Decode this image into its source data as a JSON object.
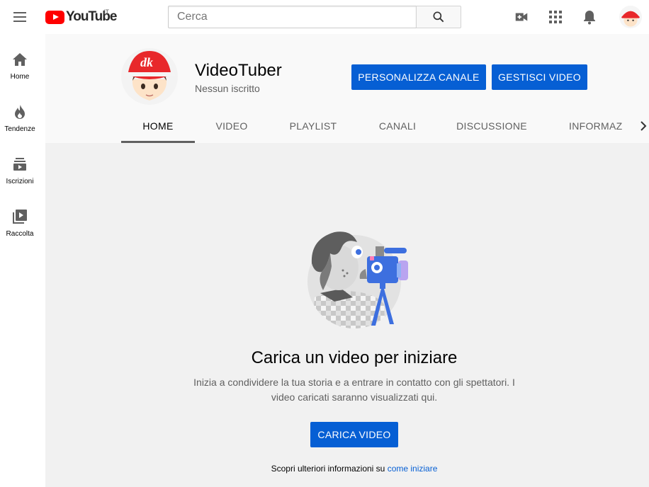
{
  "topbar": {
    "logo_text": "YouTube",
    "country_code": "IT",
    "search_placeholder": "Cerca"
  },
  "sidebar": {
    "items": [
      {
        "label": "Home",
        "icon": "home-icon"
      },
      {
        "label": "Tendenze",
        "icon": "flame-icon"
      },
      {
        "label": "Iscrizioni",
        "icon": "subscriptions-icon"
      },
      {
        "label": "Raccolta",
        "icon": "library-icon"
      }
    ]
  },
  "channel": {
    "avatar_text": "dk",
    "name": "VideoTuber",
    "subscribers": "Nessun iscritto",
    "customize_label": "PERSONALIZZA CANALE",
    "manage_label": "GESTISCI VIDEO",
    "tabs": [
      "HOME",
      "VIDEO",
      "PLAYLIST",
      "CANALI",
      "DISCUSSIONE",
      "INFORMAZIONI"
    ],
    "active_tab": "HOME"
  },
  "empty_state": {
    "title": "Carica un video per iniziare",
    "text": "Inizia a condividere la tua storia e a entrare in contatto con gli spettatori. I video caricati saranno visualizzati qui.",
    "upload_label": "CARICA VIDEO",
    "footer_prefix": "Scopri ulteriori informazioni su",
    "footer_link": "come iniziare"
  },
  "colors": {
    "brand_red": "#ff0000",
    "accent_blue": "#065fd4"
  }
}
